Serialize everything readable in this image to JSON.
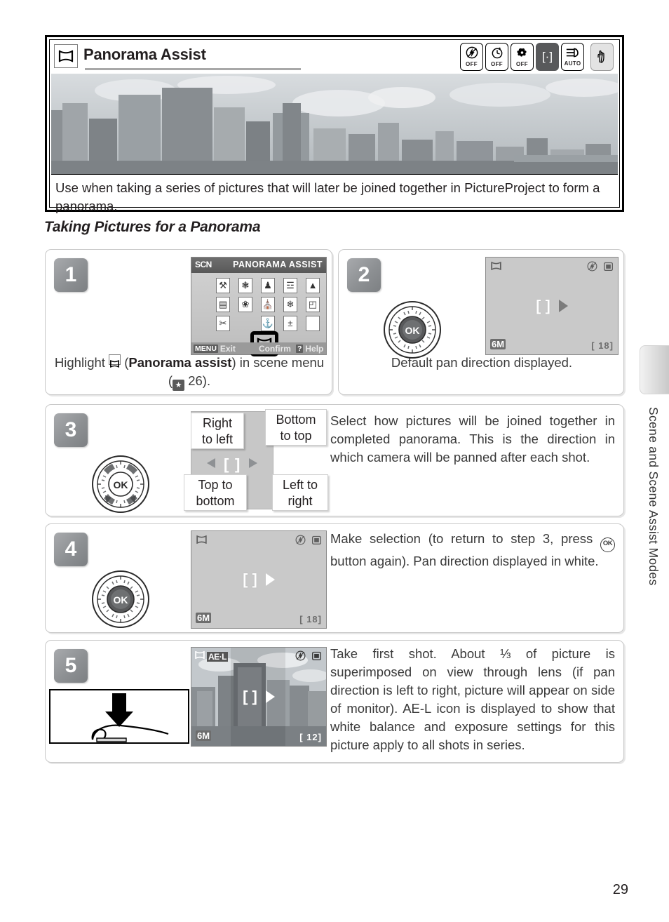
{
  "document": {
    "page_number": "29",
    "side_tab_label": "Scene and Scene Assist Modes"
  },
  "feature_box": {
    "icon": "panorama-icon",
    "title": "Panorama Assist",
    "status_icons": [
      {
        "name": "flash-off-icon",
        "glyph": "⚡",
        "sub": "OFF"
      },
      {
        "name": "self-timer-off-icon",
        "glyph": "⏱",
        "sub": "OFF"
      },
      {
        "name": "macro-off-icon",
        "glyph": "❀",
        "sub": "OFF"
      },
      {
        "name": "af-area-icon",
        "glyph": "[·]",
        "sub": ""
      },
      {
        "name": "exposure-auto-icon",
        "glyph": "☰D",
        "sub": "AUTO"
      },
      {
        "name": "vibration-reduction-icon",
        "glyph": "✋",
        "sub": ""
      }
    ],
    "photo_alt": "city skyline panorama",
    "description": "Use when taking a series of pictures that will later be joined together in PictureProject to form a panorama."
  },
  "section": {
    "heading": "Taking Pictures for a Panorama"
  },
  "steps": [
    {
      "number": "1",
      "caption_parts": {
        "before": "Highlight ",
        "bold": "Panorama assist",
        "middle": ") in scene menu (",
        "page_ref": "26",
        "after": ")."
      },
      "scene_menu": {
        "mode_label": "SCN",
        "title": "PANORAMA ASSIST",
        "icons": [
          "⚒",
          "❃",
          "♟",
          "☲",
          "▲",
          "▤",
          "❀",
          "⛪",
          "❄",
          "◰",
          "✂",
          "❖",
          "⚓",
          "±",
          ""
        ],
        "selected_index": 11,
        "footer": [
          {
            "key": "MENU",
            "label": "Exit"
          },
          {
            "key": "",
            "label": "Confirm"
          },
          {
            "key": "?",
            "label": "Help"
          }
        ]
      }
    },
    {
      "number": "2",
      "caption": "Default pan direction displayed.",
      "lcd": {
        "mode_icon": "panorama-icon",
        "flash_icon": "flash-off-icon",
        "battery_icon": "battery-icon",
        "resolution": "6M",
        "shots_remaining": "18",
        "arrow_style": "filled"
      }
    },
    {
      "number": "3",
      "text": "Select how pictures will be joined together in completed panorama.  This is the direction in which camera will be panned after each shot.",
      "callouts": {
        "right_to_left": "Right to left",
        "bottom_to_top": "Bottom to top",
        "top_to_bottom": "Top to bottom",
        "left_to_right": "Left to right"
      }
    },
    {
      "number": "4",
      "text_parts": {
        "before": "Make selection (to return to step 3, press ",
        "after": " button again).  Pan direction displayed in white."
      },
      "lcd": {
        "mode_icon": "panorama-icon",
        "flash_icon": "flash-off-icon",
        "battery_icon": "battery-icon",
        "resolution": "6M",
        "shots_remaining": "18",
        "arrow_style": "white"
      }
    },
    {
      "number": "5",
      "text": "Take first shot.  About ⅓ of picture is superimposed on view through lens (if pan direction is left to right, picture will appear on side of monitor).  AE-L icon is displayed to show that white balance and exposure settings for this picture apply to all shots in series.",
      "lcd": {
        "mode_icon": "panorama-icon",
        "ae_lock_label": "AE·L",
        "flash_icon": "flash-off-icon",
        "battery_icon": "battery-icon",
        "resolution": "6M",
        "shots_remaining": "12",
        "arrow_style": "white"
      },
      "shutter_hint": "press-shutter-button"
    }
  ],
  "colors": {
    "step_badge": "#8d9093",
    "lcd_background": "#c9c9c9",
    "panel_border": "#c9c9c9",
    "text": "#231f20"
  }
}
